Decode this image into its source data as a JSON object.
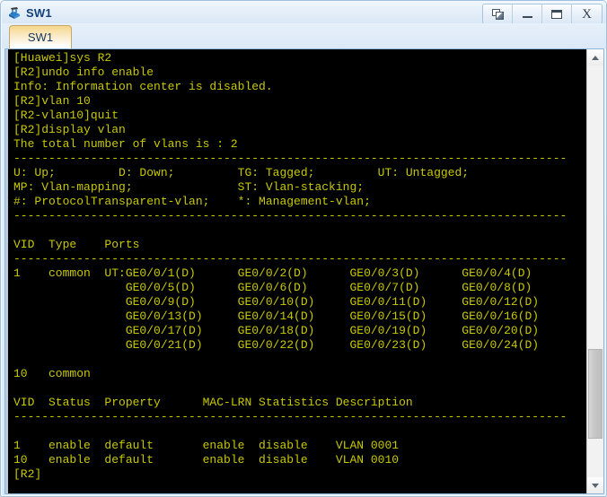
{
  "window": {
    "title": "SW1",
    "icon": "switch-icon",
    "buttons": {
      "restore": "restore-window",
      "minimize": "_",
      "maximize": "maximize-window",
      "close": "X"
    }
  },
  "tabs": [
    {
      "label": "SW1",
      "active": true
    }
  ],
  "terminal": {
    "fg_color": "#c8c800",
    "bg_color": "#000000",
    "lines": [
      "[Huawei]sys R2",
      "[R2]undo info enable",
      "Info: Information center is disabled.",
      "[R2]vlan 10",
      "[R2-vlan10]quit",
      "[R2]display vlan",
      "The total number of vlans is : 2",
      "-------------------------------------------------------------------------------",
      "U: Up;         D: Down;         TG: Tagged;         UT: Untagged;",
      "MP: Vlan-mapping;               ST: Vlan-stacking;",
      "#: ProtocolTransparent-vlan;    *: Management-vlan;",
      "-------------------------------------------------------------------------------",
      "",
      "VID  Type    Ports",
      "-------------------------------------------------------------------------------",
      "1    common  UT:GE0/0/1(D)      GE0/0/2(D)      GE0/0/3(D)      GE0/0/4(D)",
      "                GE0/0/5(D)      GE0/0/6(D)      GE0/0/7(D)      GE0/0/8(D)",
      "                GE0/0/9(D)      GE0/0/10(D)     GE0/0/11(D)     GE0/0/12(D)",
      "                GE0/0/13(D)     GE0/0/14(D)     GE0/0/15(D)     GE0/0/16(D)",
      "                GE0/0/17(D)     GE0/0/18(D)     GE0/0/19(D)     GE0/0/20(D)",
      "                GE0/0/21(D)     GE0/0/22(D)     GE0/0/23(D)     GE0/0/24(D)",
      "",
      "10   common",
      "",
      "VID  Status  Property      MAC-LRN Statistics Description",
      "-------------------------------------------------------------------------------",
      "",
      "1    enable  default       enable  disable    VLAN 0001",
      "10   enable  default       enable  disable    VLAN 0010",
      "[R2]"
    ]
  },
  "scrollbar": {
    "up_arrow": "scroll-up",
    "down_arrow": "scroll-down",
    "thumb_position_percent": 88
  }
}
